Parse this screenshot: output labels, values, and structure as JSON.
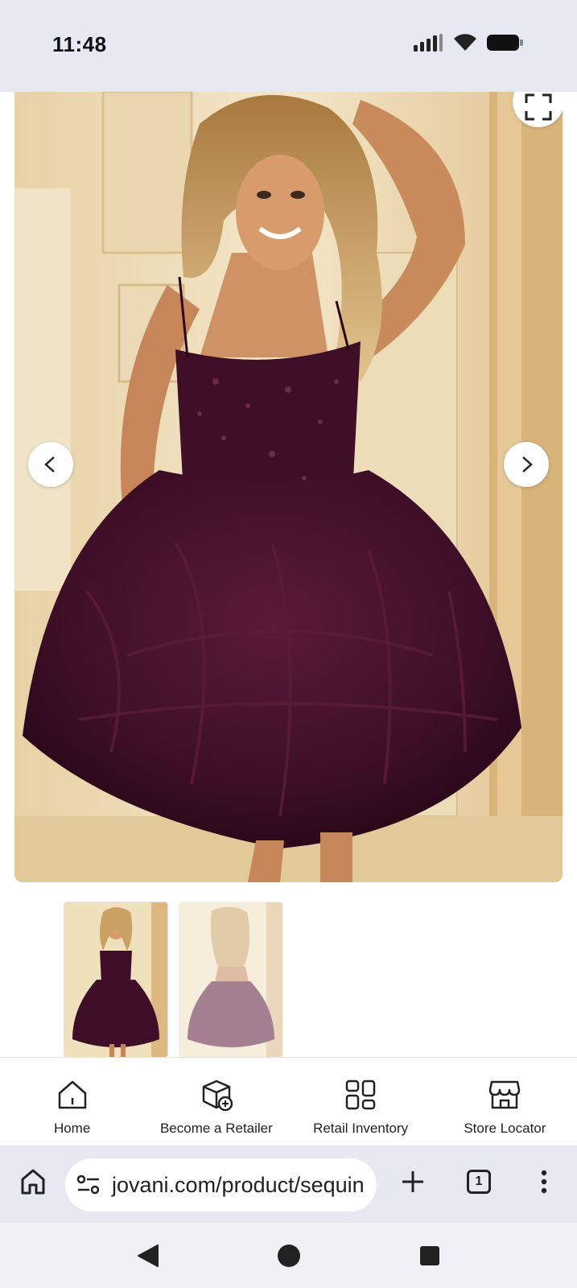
{
  "status_bar": {
    "time": "11:48",
    "icons": [
      "signal-icon",
      "wifi-icon",
      "battery-icon"
    ]
  },
  "product_gallery": {
    "current_image": "sequin dress photo front",
    "fullscreen_icon": "fullscreen-icon",
    "prev_icon": "chevron-left-icon",
    "next_icon": "chevron-right-icon",
    "thumbnails": [
      {
        "name": "front view",
        "selected": true
      },
      {
        "name": "back view",
        "selected": false
      }
    ],
    "colors": {
      "dress": "#3e0f27",
      "background": "#efe0bf"
    }
  },
  "bottom_nav": {
    "items": [
      {
        "label": "Home",
        "icon": "home-icon"
      },
      {
        "label": "Become a Retailer",
        "icon": "box-add-icon"
      },
      {
        "label": "Retail Inventory",
        "icon": "grid-icon"
      },
      {
        "label": "Store Locator",
        "icon": "store-icon"
      }
    ]
  },
  "browser": {
    "url": "jovani.com/product/sequin",
    "tab_count": "1",
    "icons": [
      "home-icon",
      "site-settings-icon",
      "new-tab-icon",
      "tabs-icon",
      "menu-icon"
    ]
  },
  "system_nav": {
    "icons": [
      "back-icon",
      "home-circle-icon",
      "recents-icon"
    ]
  }
}
